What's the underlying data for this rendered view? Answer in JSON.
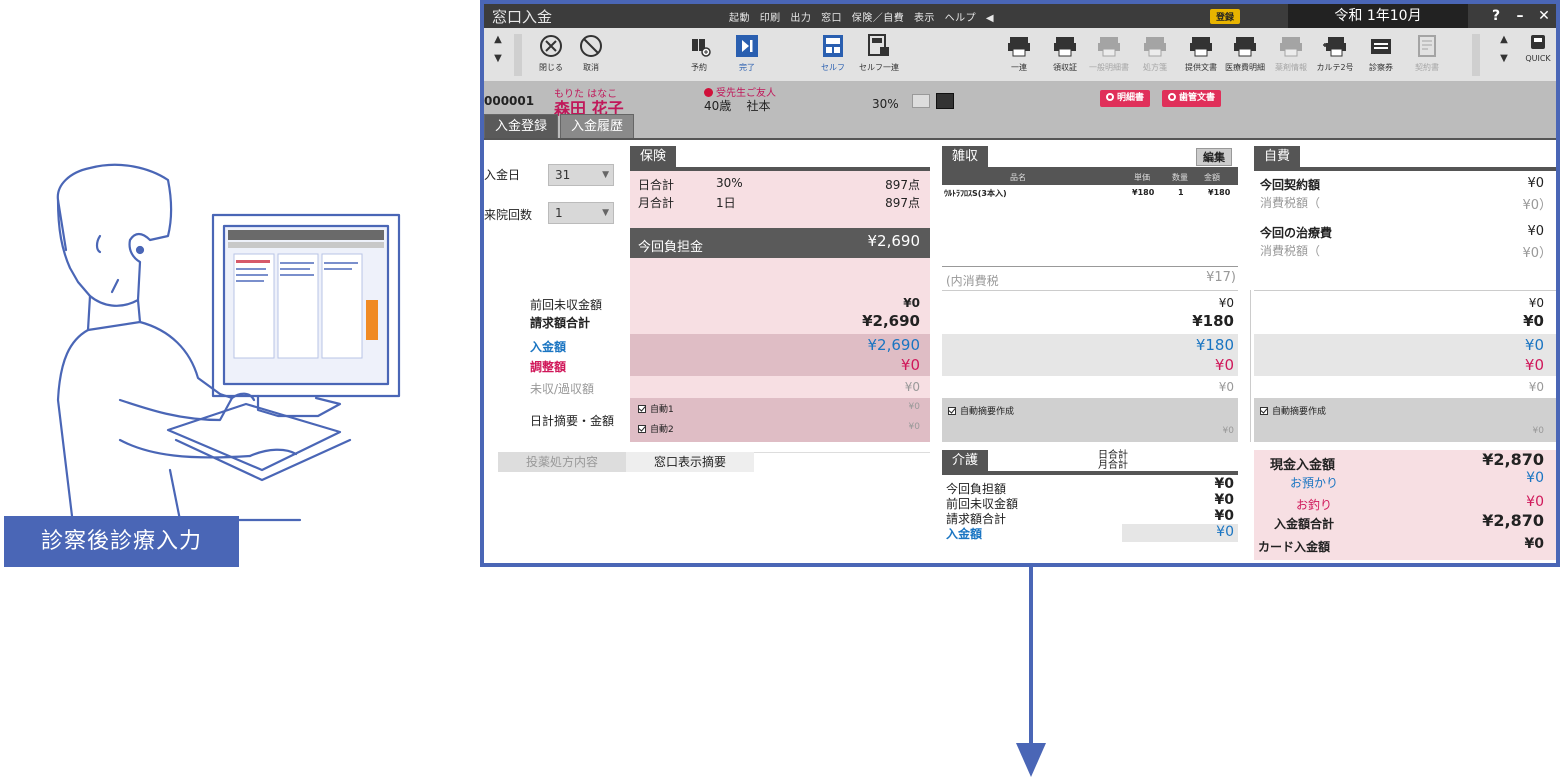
{
  "illustration": {
    "label": "診察後診療入力"
  },
  "window": {
    "title": "窓口入金",
    "menu": [
      "起動",
      "印刷",
      "出力",
      "窓口",
      "保険／自費",
      "表示",
      "ヘルプ"
    ],
    "badge": "登録",
    "date": "令和 1年10月",
    "controls": [
      "?",
      "–",
      "✕"
    ]
  },
  "toolbar": {
    "close": "閉じる",
    "cancel": "取消",
    "reserve": "予約",
    "complete": "完了",
    "self": "セルフ",
    "self_all": "セルフ一連",
    "all": "一連",
    "receipt_issue": "領収証",
    "record": "一般明細書",
    "output": "処方箋",
    "provision": "提供文書",
    "medical_detail": "医療費明細",
    "info": "薬剤情報",
    "karte2": "カルテ2号",
    "exam": "診察券",
    "contract": "契約書",
    "quick": "QUICK"
  },
  "patient": {
    "id": "000001",
    "kana": "もりた はなこ",
    "name": "森田 花子",
    "warning": "受先生ご友人",
    "age": "40歳",
    "insurance": "社本",
    "rate": "30%",
    "btn_detail": "明細書",
    "btn_docs": "歯管文書"
  },
  "tabs": [
    "入金登録",
    "入金履歴"
  ],
  "left": {
    "date_label": "入金日",
    "date_value": "31",
    "visits_label": "来院回数",
    "visits_value": "1"
  },
  "insurance": {
    "header": "保険",
    "daily_label": "日合計",
    "daily_rate": "30%",
    "daily_points": "897点",
    "monthly_label": "月合計",
    "monthly_days": "1日",
    "monthly_points": "897点",
    "burden_label": "今回負担金",
    "burden_value": "¥2,690",
    "prev_label": "前回未収金額",
    "prev_value": "¥0",
    "bill_label": "請求額合計",
    "bill_value": "¥2,690",
    "paid_label": "入金額",
    "paid_value": "¥2,690",
    "adjust_label": "調整額",
    "adjust_value": "¥0",
    "unpaid_label": "未収/過収額",
    "unpaid_value": "¥0",
    "summary_label": "日計摘要・金額",
    "auto1": "自動1",
    "auto1_value": "¥0",
    "auto2": "自動2",
    "auto2_value": "¥0"
  },
  "misc": {
    "header": "雑収",
    "edit": "編集",
    "cols": [
      "品名",
      "単価",
      "数量",
      "金額"
    ],
    "item": {
      "name": "ｳﾙﾄﾗﾌﾛｽS(3本入)",
      "price": "¥180",
      "qty": "1",
      "amount": "¥180"
    },
    "tax_label": "(内消費税",
    "tax_value": "¥17)",
    "prev_value": "¥0",
    "bill_value": "¥180",
    "paid_value": "¥180",
    "adjust_value": "¥0",
    "unpaid_value": "¥0",
    "auto_summary": "自動摘要作成",
    "auto_value": "¥0"
  },
  "self_pay": {
    "header": "自費",
    "contract_label": "今回契約額",
    "contract_value": "¥0",
    "tax1_label": "消費税額（",
    "tax1_value": "¥0）",
    "treatment_label": "今回の治療費",
    "treatment_value": "¥0",
    "tax2_label": "消費税額（",
    "tax2_value": "¥0）",
    "prev_value": "¥0",
    "bill_value": "¥0",
    "paid_value": "¥0",
    "adjust_value": "¥0",
    "unpaid_value": "¥0",
    "auto_summary": "自動摘要作成",
    "auto_value": "¥0"
  },
  "bottom": {
    "tab_rx": "投薬処方内容",
    "tab_window": "窓口表示摘要"
  },
  "care": {
    "header": "介護",
    "daily": "日合計",
    "monthly": "月合計",
    "burden_label": "今回負担額",
    "burden_value": "¥0",
    "prev_label": "前回未収金額",
    "prev_value": "¥0",
    "bill_label": "請求額合計",
    "bill_value": "¥0",
    "paid_label": "入金額",
    "paid_value": "¥0"
  },
  "totals": {
    "cash_label": "現金入金額",
    "cash_value": "¥2,870",
    "deposit_label": "お預かり",
    "deposit_value": "¥0",
    "change_label": "お釣り",
    "change_value": "¥0",
    "total_label": "入金額合計",
    "total_value": "¥2,870",
    "card_label": "カード入金額",
    "card_value": "¥0"
  },
  "colors": {
    "accent": "#4a66b6",
    "pink": "#f7dfe3",
    "blue_text": "#1a75c2",
    "red_text": "#d0185a"
  }
}
